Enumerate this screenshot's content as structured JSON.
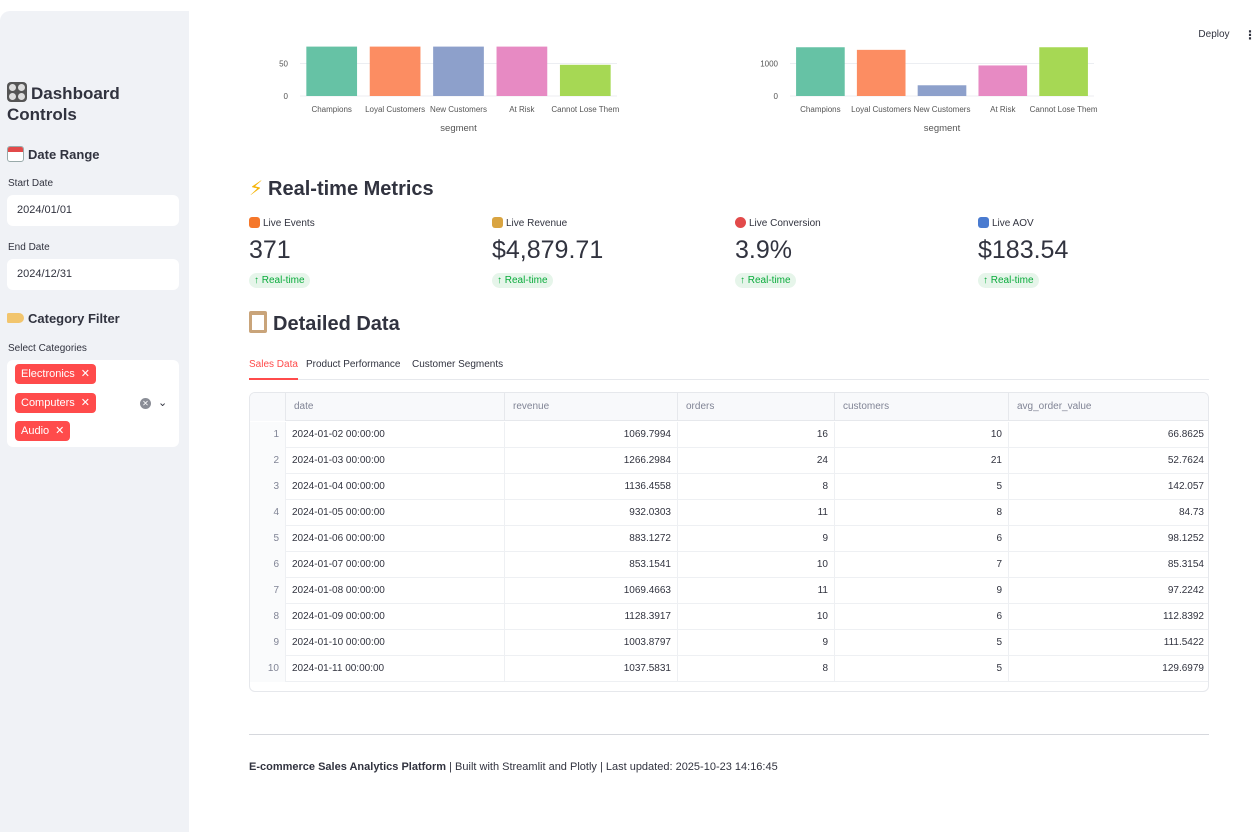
{
  "sidebar": {
    "title": "Dashboard Controls",
    "date_range": {
      "heading": "Date Range",
      "start_label": "Start Date",
      "start_value": "2024/01/01",
      "end_label": "End Date",
      "end_value": "2024/12/31"
    },
    "category_filter": {
      "heading": "Category Filter",
      "select_label": "Select Categories",
      "selected": [
        "Electronics",
        "Computers",
        "Audio"
      ],
      "chip_color": "#ff4b4b"
    }
  },
  "header": {
    "deploy_label": "Deploy",
    "menu_icon": "kebab-menu-icon"
  },
  "chart_data": [
    {
      "type": "bar",
      "categories": [
        "Champions",
        "Loyal Customers",
        "New Customers",
        "At Risk",
        "Cannot Lose Them"
      ],
      "values": [
        76,
        76,
        76,
        76,
        48
      ],
      "xlabel": "segment",
      "ylabel": "",
      "yticks": [
        0,
        50
      ],
      "colors": [
        "#66c2a5",
        "#fc8d62",
        "#8da0cb",
        "#e78ac3",
        "#a6d854"
      ]
    },
    {
      "type": "bar",
      "categories": [
        "Champions",
        "Loyal Customers",
        "New Customers",
        "At Risk",
        "Cannot Lose Them"
      ],
      "values": [
        1500,
        1420,
        330,
        940,
        1500
      ],
      "xlabel": "segment",
      "ylabel": "",
      "yticks": [
        0,
        1000
      ],
      "colors": [
        "#66c2a5",
        "#fc8d62",
        "#8da0cb",
        "#e78ac3",
        "#a6d854"
      ]
    }
  ],
  "realtime": {
    "heading": "Real-time Metrics",
    "metrics": [
      {
        "label": "Live Events",
        "value": "371",
        "delta": "↑ Real-time",
        "icon": "fire-icon",
        "icon_color": "#f5772a"
      },
      {
        "label": "Live Revenue",
        "value": "$4,879.71",
        "delta": "↑ Real-time",
        "icon": "money-bag-icon",
        "icon_color": "#d9a441"
      },
      {
        "label": "Live Conversion",
        "value": "3.9%",
        "delta": "↑ Real-time",
        "icon": "target-icon",
        "icon_color": "#e24a4a"
      },
      {
        "label": "Live AOV",
        "value": "$183.54",
        "delta": "↑ Real-time",
        "icon": "bar-chart-icon",
        "icon_color": "#4a7bd0"
      }
    ]
  },
  "detailed": {
    "heading": "Detailed Data",
    "tabs": [
      "Sales Data",
      "Product Performance",
      "Customer Segments"
    ],
    "active_tab": 0,
    "columns": [
      "date",
      "revenue",
      "orders",
      "customers",
      "avg_order_value"
    ],
    "rows": [
      [
        "1",
        "2024-01-02 00:00:00",
        "1069.7994",
        "16",
        "10",
        "66.8625"
      ],
      [
        "2",
        "2024-01-03 00:00:00",
        "1266.2984",
        "24",
        "21",
        "52.7624"
      ],
      [
        "3",
        "2024-01-04 00:00:00",
        "1136.4558",
        "8",
        "5",
        "142.057"
      ],
      [
        "4",
        "2024-01-05 00:00:00",
        "932.0303",
        "11",
        "8",
        "84.73"
      ],
      [
        "5",
        "2024-01-06 00:00:00",
        "883.1272",
        "9",
        "6",
        "98.1252"
      ],
      [
        "6",
        "2024-01-07 00:00:00",
        "853.1541",
        "10",
        "7",
        "85.3154"
      ],
      [
        "7",
        "2024-01-08 00:00:00",
        "1069.4663",
        "11",
        "9",
        "97.2242"
      ],
      [
        "8",
        "2024-01-09 00:00:00",
        "1128.3917",
        "10",
        "6",
        "112.8392"
      ],
      [
        "9",
        "2024-01-10 00:00:00",
        "1003.8797",
        "9",
        "5",
        "111.5422"
      ],
      [
        "10",
        "2024-01-11 00:00:00",
        "1037.5831",
        "8",
        "5",
        "129.6979"
      ]
    ]
  },
  "footer": {
    "brand": "E-commerce Sales Analytics Platform",
    "rest": " | Built with Streamlit and Plotly | Last updated: 2025-10-23 14:16:45"
  }
}
